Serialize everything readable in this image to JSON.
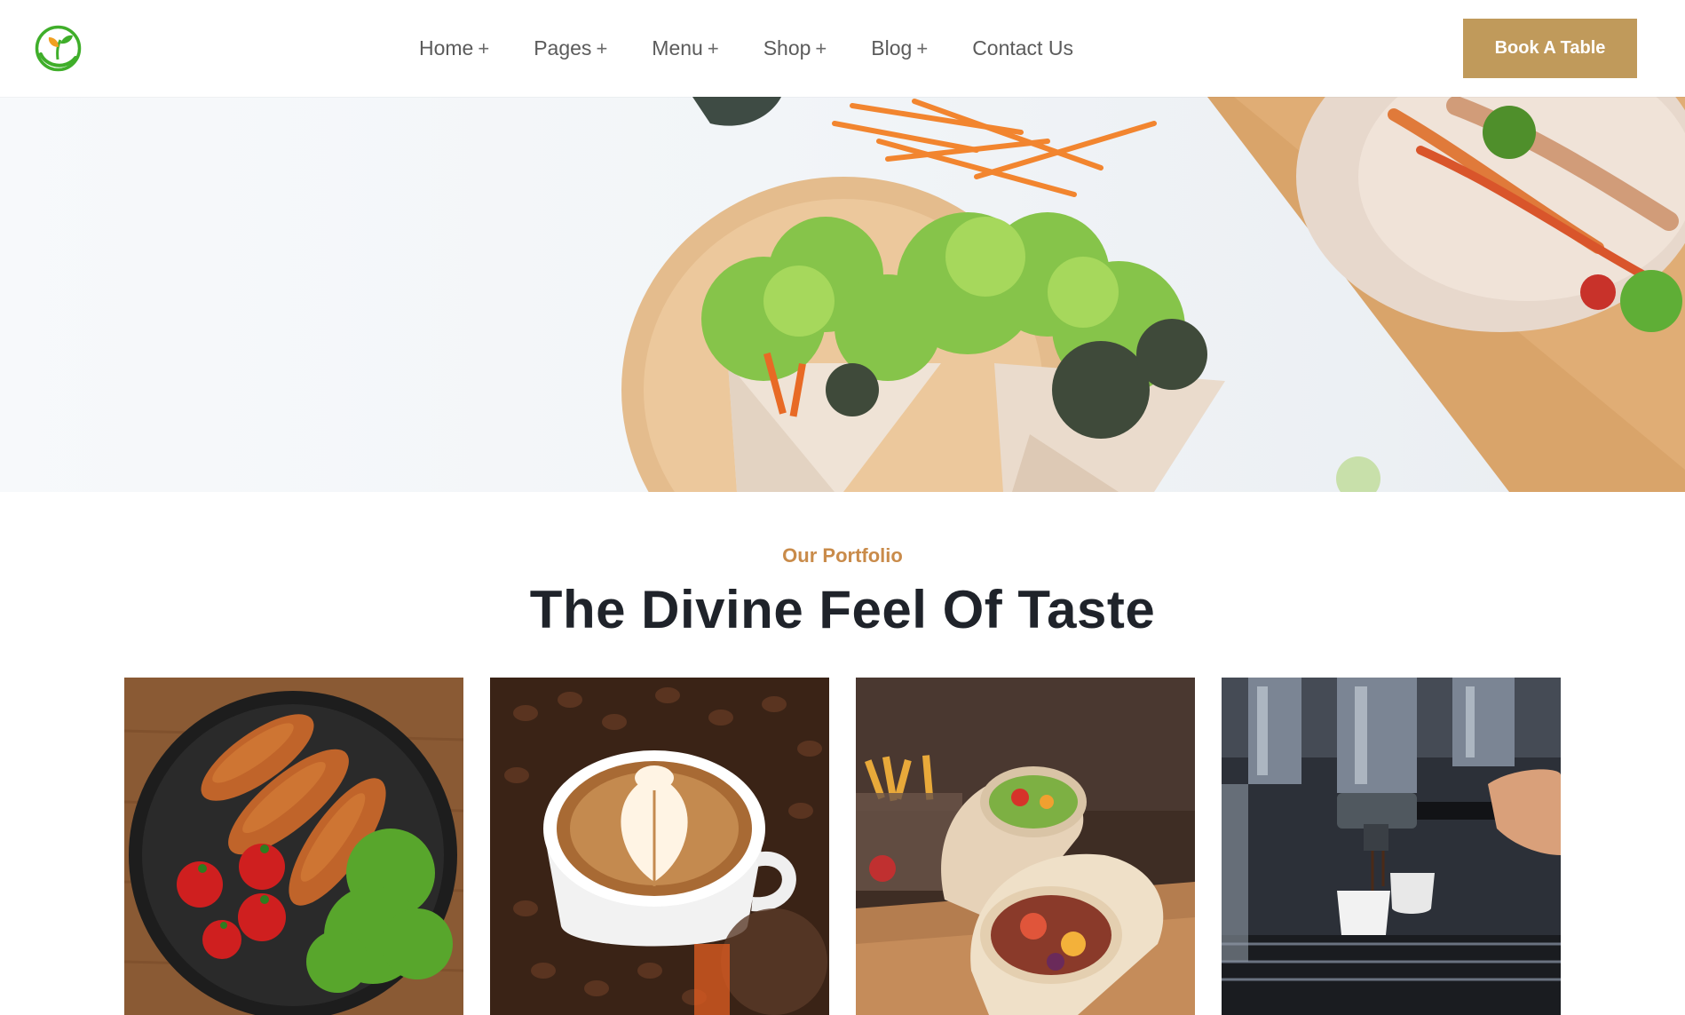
{
  "header": {
    "logo_icon": "leaf-sprout-icon",
    "nav": [
      {
        "label": "Home",
        "has_dropdown": true
      },
      {
        "label": "Pages",
        "has_dropdown": true
      },
      {
        "label": "Menu",
        "has_dropdown": true
      },
      {
        "label": "Shop",
        "has_dropdown": true
      },
      {
        "label": "Blog",
        "has_dropdown": true
      },
      {
        "label": "Contact Us",
        "has_dropdown": false
      }
    ],
    "dropdown_symbol": "+",
    "cta_label": "Book A Table"
  },
  "hero": {
    "image": "salad-wraps-on-wooden-board-photo"
  },
  "portfolio": {
    "eyebrow": "Our Portfolio",
    "title": "The Divine Feel Of Taste",
    "items": [
      {
        "image": "fried-chicken-with-tomatoes-photo"
      },
      {
        "image": "latte-art-coffee-photo"
      },
      {
        "image": "burrito-wrap-photo"
      },
      {
        "image": "espresso-machine-photo"
      }
    ]
  },
  "colors": {
    "accent": "#c09a5b",
    "eyebrow": "#c98b4a",
    "heading": "#1f232a",
    "nav_text": "#5b5b5b",
    "logo_green": "#3fae2a"
  }
}
